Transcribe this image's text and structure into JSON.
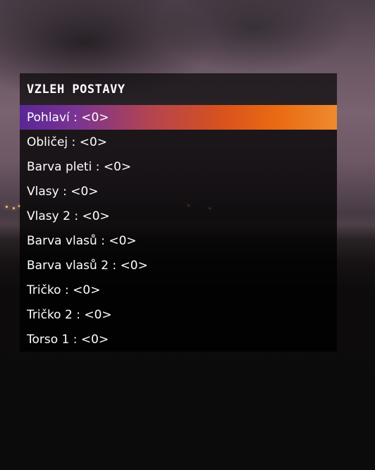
{
  "menu": {
    "title": "VZLEH POSTAVY",
    "selected_index": 0,
    "accent_gradient": [
      "#5a2696",
      "#b5444e",
      "#ea6c13"
    ],
    "items": [
      {
        "label": "Pohlaví",
        "value": "<0>"
      },
      {
        "label": "Obličej",
        "value": "<0>"
      },
      {
        "label": "Barva pleti",
        "value": "<0>"
      },
      {
        "label": "Vlasy",
        "value": "<0>"
      },
      {
        "label": "Vlasy 2",
        "value": "<0>"
      },
      {
        "label": "Barva vlasů",
        "value": "<0>"
      },
      {
        "label": "Barva vlasů 2",
        "value": "<0>"
      },
      {
        "label": "Tričko",
        "value": "<0>"
      },
      {
        "label": "Tričko 2",
        "value": "<0>"
      },
      {
        "label": "Torso 1",
        "value": "<0>"
      }
    ]
  }
}
